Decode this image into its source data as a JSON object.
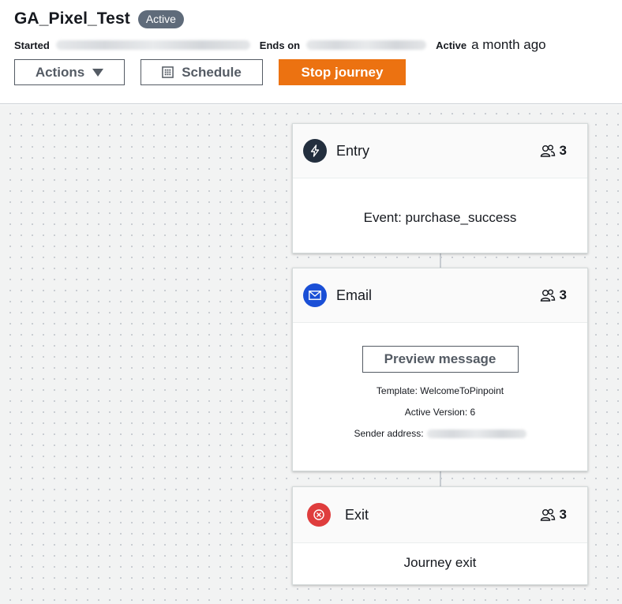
{
  "journey": {
    "title": "GA_Pixel_Test",
    "status_badge": "Active"
  },
  "meta": {
    "started_label": "Started",
    "ends_on_label": "Ends on",
    "active_label": "Active",
    "active_value": "a month ago"
  },
  "toolbar": {
    "actions_label": "Actions",
    "schedule_label": "Schedule",
    "stop_label": "Stop journey"
  },
  "nodes": {
    "entry": {
      "title": "Entry",
      "count": "3",
      "description": "Event: purchase_success"
    },
    "email": {
      "title": "Email",
      "count": "3",
      "preview_label": "Preview message",
      "template_line": "Template: WelcomeToPinpoint",
      "version_line": "Active Version: 6",
      "sender_label": "Sender address:"
    },
    "exit": {
      "title": "Exit",
      "count": "3",
      "description": "Journey exit"
    }
  },
  "colors": {
    "primary": "#ec7211",
    "badge": "#5f6b7a",
    "entry_icon": "#232f3e",
    "email_icon": "#1a4fd6",
    "exit_icon": "#df3d3d"
  },
  "icons": {
    "entry": "lightning-icon",
    "email": "envelope-icon",
    "exit": "close-circle-icon",
    "count": "people-icon",
    "schedule": "calendar-icon",
    "actions": "caret-down-icon"
  }
}
